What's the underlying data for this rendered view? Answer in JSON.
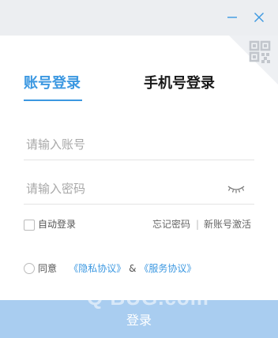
{
  "titlebar": {
    "minimize_icon": "minimize-icon",
    "close_icon": "close-icon"
  },
  "tabs": [
    {
      "label": "账号登录",
      "active": true
    },
    {
      "label": "手机号登录",
      "active": false
    }
  ],
  "form": {
    "account_placeholder": "请输入账号",
    "account_value": "",
    "password_placeholder": "请输入密码",
    "password_value": ""
  },
  "options": {
    "auto_login_label": "自动登录",
    "auto_login_checked": false,
    "forgot_password": "忘记密码",
    "separator": "|",
    "activate_account": "新账号激活"
  },
  "agreement": {
    "agree_label": "同意",
    "privacy_link": "《隐私协议》",
    "ampersand": "&",
    "service_link": "《服务协议》",
    "agreed": false
  },
  "login_button": "登录",
  "watermark": "Q BUG.com",
  "colors": {
    "accent": "#3c98e1",
    "button": "#a9cdf0",
    "titlebar": "#eceef1"
  }
}
